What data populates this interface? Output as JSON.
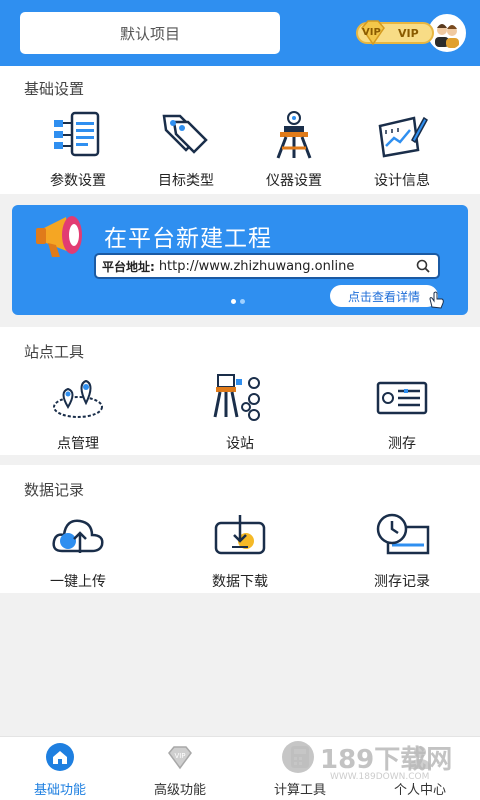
{
  "header": {
    "project_label": "默认项目",
    "vip_small": "VIP",
    "vip_large": "VIP",
    "accent": "#2f8ff0"
  },
  "basic_settings": {
    "title": "基础设置",
    "items": [
      {
        "label": "参数设置",
        "icon": "parameters-icon"
      },
      {
        "label": "目标类型",
        "icon": "target-type-icon"
      },
      {
        "label": "仪器设置",
        "icon": "instrument-icon"
      },
      {
        "label": "设计信息",
        "icon": "design-info-icon"
      }
    ]
  },
  "banner": {
    "title": "在平台新建工程",
    "url_key": "平台地址:",
    "url_value": "http://www.zhizhuwang.online",
    "detail_button": "点击查看详情"
  },
  "station_tools": {
    "title": "站点工具",
    "items": [
      {
        "label": "点管理",
        "icon": "point-management-icon"
      },
      {
        "label": "设站",
        "icon": "set-station-icon"
      },
      {
        "label": "测存",
        "icon": "measure-store-icon"
      }
    ]
  },
  "data_records": {
    "title": "数据记录",
    "items": [
      {
        "label": "一键上传",
        "icon": "cloud-upload-icon"
      },
      {
        "label": "数据下载",
        "icon": "data-download-icon"
      },
      {
        "label": "测存记录",
        "icon": "record-clock-icon"
      }
    ]
  },
  "bottom_nav": {
    "items": [
      {
        "label": "基础功能",
        "icon": "home-icon",
        "active": true
      },
      {
        "label": "高级功能",
        "icon": "vip-diamond-icon",
        "active": false
      },
      {
        "label": "计算工具",
        "icon": "calculator-icon",
        "active": false
      },
      {
        "label": "个人中心",
        "icon": "person-icon",
        "active": false
      }
    ],
    "active_color": "#1e7fe0"
  },
  "watermark": {
    "text": "189下载网",
    "sub": "WWW.189DOWN.COM"
  }
}
